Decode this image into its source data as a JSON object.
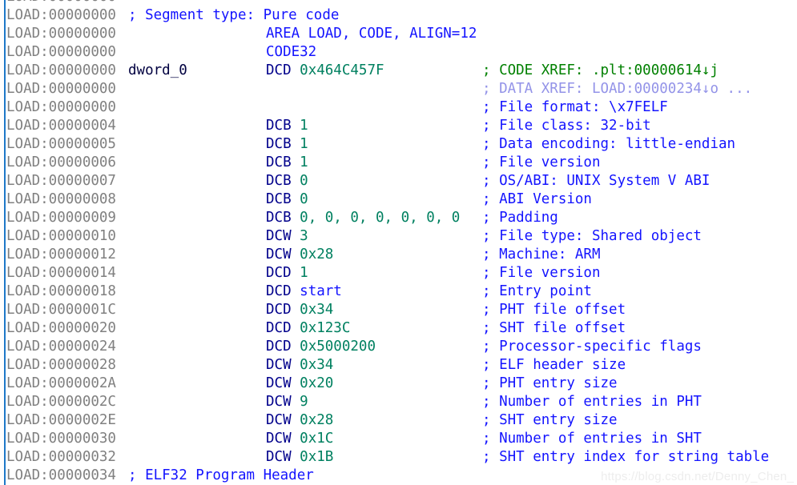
{
  "app": {
    "view": "IDA View-A disassembly listing",
    "segment": "LOAD",
    "watermark": "https://blog.csdn.net/Denny_Chen_"
  },
  "colors": {
    "address": "#808080",
    "mnemonic": "#00008B",
    "number": "#008060",
    "directive": "#1414FF",
    "comment": "#1414FF",
    "code_xref": "#008000",
    "data_xref": "#9393E8",
    "gutter_line": "#1E78C8",
    "background": "#FFFFFF",
    "watermark": "#EDEDED"
  },
  "lines": [
    {
      "address": "LOAD:00000000",
      "name": "",
      "instr": "",
      "comment": "",
      "kind": "partial"
    },
    {
      "address": "LOAD:00000000",
      "name": "",
      "inline_comment": "; Segment type: Pure code",
      "instr": "",
      "comment": "",
      "kind": "inline-comment"
    },
    {
      "address": "LOAD:00000000",
      "name": "",
      "directive": "AREA LOAD, CODE, ALIGN=12",
      "comment": "",
      "kind": "directive"
    },
    {
      "address": "LOAD:00000000",
      "name": "",
      "directive": "CODE32",
      "comment": "",
      "kind": "directive"
    },
    {
      "address": "LOAD:00000000",
      "name": "dword_0",
      "mnemonic": "DCD",
      "operand": "0x464C457F",
      "operand_kind": "number",
      "comment": "; CODE XREF: .plt:00000614↓j",
      "comment_kind": "code-xref",
      "kind": "data"
    },
    {
      "address": "LOAD:00000000",
      "name": "",
      "instr": "",
      "comment": "; DATA XREF: LOAD:00000234↓o ...",
      "comment_kind": "data-xref",
      "kind": "xref-only"
    },
    {
      "address": "LOAD:00000000",
      "name": "",
      "instr": "",
      "comment": "; File format: \\x7FELF",
      "comment_kind": "comment",
      "kind": "comment-only"
    },
    {
      "address": "LOAD:00000004",
      "name": "",
      "mnemonic": "DCB",
      "operand": "1",
      "operand_kind": "number",
      "comment": "; File class: 32-bit",
      "comment_kind": "comment",
      "kind": "data"
    },
    {
      "address": "LOAD:00000005",
      "name": "",
      "mnemonic": "DCB",
      "operand": "1",
      "operand_kind": "number",
      "comment": "; Data encoding: little-endian",
      "comment_kind": "comment",
      "kind": "data"
    },
    {
      "address": "LOAD:00000006",
      "name": "",
      "mnemonic": "DCB",
      "operand": "1",
      "operand_kind": "number",
      "comment": "; File version",
      "comment_kind": "comment",
      "kind": "data"
    },
    {
      "address": "LOAD:00000007",
      "name": "",
      "mnemonic": "DCB",
      "operand": "0",
      "operand_kind": "number",
      "comment": "; OS/ABI: UNIX System V ABI",
      "comment_kind": "comment",
      "kind": "data"
    },
    {
      "address": "LOAD:00000008",
      "name": "",
      "mnemonic": "DCB",
      "operand": "0",
      "operand_kind": "number",
      "comment": "; ABI Version",
      "comment_kind": "comment",
      "kind": "data"
    },
    {
      "address": "LOAD:00000009",
      "name": "",
      "mnemonic": "DCB",
      "operand": "0, 0, 0, 0, 0, 0, 0",
      "operand_kind": "number-list",
      "comment": "; Padding",
      "comment_kind": "comment",
      "kind": "data"
    },
    {
      "address": "LOAD:00000010",
      "name": "",
      "mnemonic": "DCW",
      "operand": "3",
      "operand_kind": "number",
      "comment": "; File type: Shared object",
      "comment_kind": "comment",
      "kind": "data"
    },
    {
      "address": "LOAD:00000012",
      "name": "",
      "mnemonic": "DCW",
      "operand": "0x28",
      "operand_kind": "number",
      "comment": "; Machine: ARM",
      "comment_kind": "comment",
      "kind": "data"
    },
    {
      "address": "LOAD:00000014",
      "name": "",
      "mnemonic": "DCD",
      "operand": "1",
      "operand_kind": "number",
      "comment": "; File version",
      "comment_kind": "comment",
      "kind": "data"
    },
    {
      "address": "LOAD:00000018",
      "name": "",
      "mnemonic": "DCD",
      "operand": "start",
      "operand_kind": "name",
      "comment": "; Entry point",
      "comment_kind": "comment",
      "kind": "data"
    },
    {
      "address": "LOAD:0000001C",
      "name": "",
      "mnemonic": "DCD",
      "operand": "0x34",
      "operand_kind": "number",
      "comment": "; PHT file offset",
      "comment_kind": "comment",
      "kind": "data"
    },
    {
      "address": "LOAD:00000020",
      "name": "",
      "mnemonic": "DCD",
      "operand": "0x123C",
      "operand_kind": "number",
      "comment": "; SHT file offset",
      "comment_kind": "comment",
      "kind": "data"
    },
    {
      "address": "LOAD:00000024",
      "name": "",
      "mnemonic": "DCD",
      "operand": "0x5000200",
      "operand_kind": "number",
      "comment": "; Processor-specific flags",
      "comment_kind": "comment",
      "kind": "data"
    },
    {
      "address": "LOAD:00000028",
      "name": "",
      "mnemonic": "DCW",
      "operand": "0x34",
      "operand_kind": "number",
      "comment": "; ELF header size",
      "comment_kind": "comment",
      "kind": "data"
    },
    {
      "address": "LOAD:0000002A",
      "name": "",
      "mnemonic": "DCW",
      "operand": "0x20",
      "operand_kind": "number",
      "comment": "; PHT entry size",
      "comment_kind": "comment",
      "kind": "data"
    },
    {
      "address": "LOAD:0000002C",
      "name": "",
      "mnemonic": "DCW",
      "operand": "9",
      "operand_kind": "number",
      "comment": "; Number of entries in PHT",
      "comment_kind": "comment",
      "kind": "data"
    },
    {
      "address": "LOAD:0000002E",
      "name": "",
      "mnemonic": "DCW",
      "operand": "0x28",
      "operand_kind": "number",
      "comment": "; SHT entry size",
      "comment_kind": "comment",
      "kind": "data"
    },
    {
      "address": "LOAD:00000030",
      "name": "",
      "mnemonic": "DCW",
      "operand": "0x1C",
      "operand_kind": "number",
      "comment": "; Number of entries in SHT",
      "comment_kind": "comment",
      "kind": "data"
    },
    {
      "address": "LOAD:00000032",
      "name": "",
      "mnemonic": "DCW",
      "operand": "0x1B",
      "operand_kind": "number",
      "comment": "; SHT entry index for string table",
      "comment_kind": "comment",
      "kind": "data"
    },
    {
      "address": "LOAD:00000034",
      "name": "",
      "inline_comment": "; ELF32 Program Header",
      "instr": "",
      "comment": "",
      "kind": "inline-comment"
    }
  ]
}
